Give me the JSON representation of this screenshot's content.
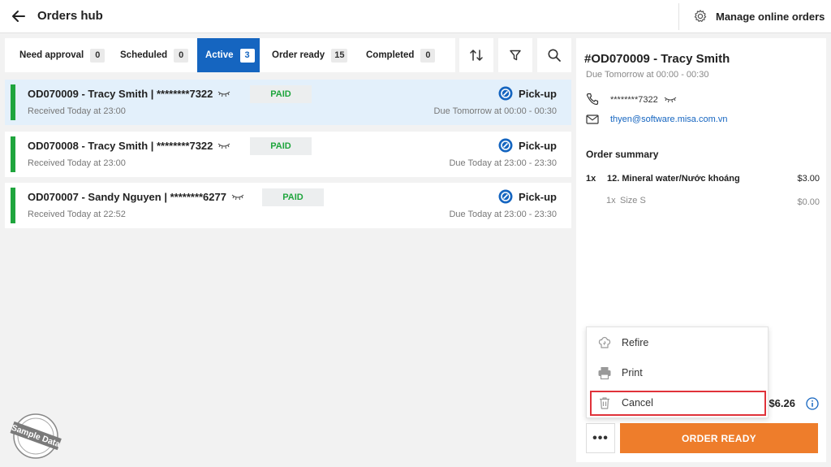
{
  "header": {
    "title": "Orders hub",
    "manage_label": "Manage online orders"
  },
  "tabs": [
    {
      "label": "Need approval",
      "count": "0"
    },
    {
      "label": "Scheduled",
      "count": "0"
    },
    {
      "label": "Active",
      "count": "3",
      "active": true
    },
    {
      "label": "Order ready",
      "count": "15"
    },
    {
      "label": "Completed",
      "count": "0"
    }
  ],
  "orders": [
    {
      "name": "OD070009 - Tracy Smith | ********7322",
      "status": "PAID",
      "method": "Pick-up",
      "received": "Received Today at 23:00",
      "due": "Due Tomorrow at 00:00 - 00:30"
    },
    {
      "name": "OD070008 - Tracy Smith | ********7322",
      "status": "PAID",
      "method": "Pick-up",
      "received": "Received Today at 23:00",
      "due": "Due Today at 23:00 - 23:30"
    },
    {
      "name": "OD070007 - Sandy Nguyen | ********6277",
      "status": "PAID",
      "method": "Pick-up",
      "received": "Received Today at 22:52",
      "due": "Due Today at 23:00 - 23:30"
    }
  ],
  "detail": {
    "title": "#OD070009 - Tracy Smith",
    "due": "Due Tomorrow at 00:00 - 00:30",
    "phone": "********7322",
    "email": "thyen@software.misa.com.vn",
    "summary_title": "Order summary",
    "item": {
      "qty": "1x",
      "name": "12. Mineral water/Nước khoáng",
      "price": "$3.00"
    },
    "modifier": {
      "qty": "1x",
      "name": "Size S",
      "price": "$0.00"
    },
    "total": "$6.26",
    "more_label": "•••",
    "order_ready_label": "ORDER READY"
  },
  "menu": {
    "refire": "Refire",
    "print": "Print",
    "cancel": "Cancel"
  },
  "watermark": "Sample Data",
  "colors": {
    "accent": "#1565c0",
    "paid": "#1fa53d",
    "order_ready": "#ee7d2b",
    "highlight": "#e0323a"
  }
}
